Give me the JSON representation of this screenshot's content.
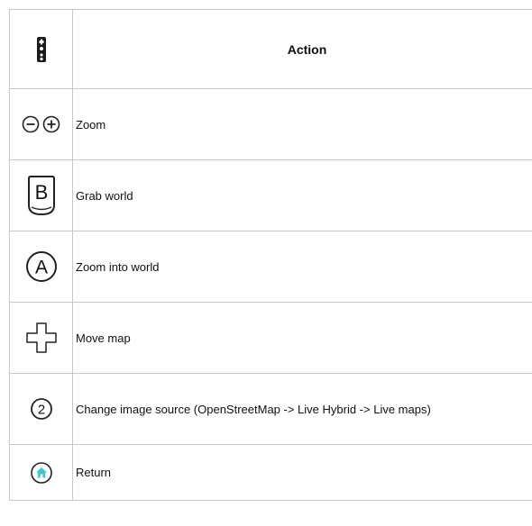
{
  "table": {
    "header": {
      "action_label": "Action",
      "icon": "wiimote-icon"
    },
    "rows": [
      {
        "icon": "zoom-minus-plus-icon",
        "action": "Zoom"
      },
      {
        "icon": "b-button-icon",
        "action": "Grab world"
      },
      {
        "icon": "a-button-icon",
        "action": "Zoom into world"
      },
      {
        "icon": "dpad-icon",
        "action": "Move map"
      },
      {
        "icon": "button-2-icon",
        "action": "Change image source (OpenStreetMap -> Live Hybrid -> Live maps)"
      },
      {
        "icon": "home-button-icon",
        "action": "Return"
      }
    ]
  },
  "colors": {
    "border": "#c8c8c8",
    "home_accent": "#3fc6c6"
  }
}
